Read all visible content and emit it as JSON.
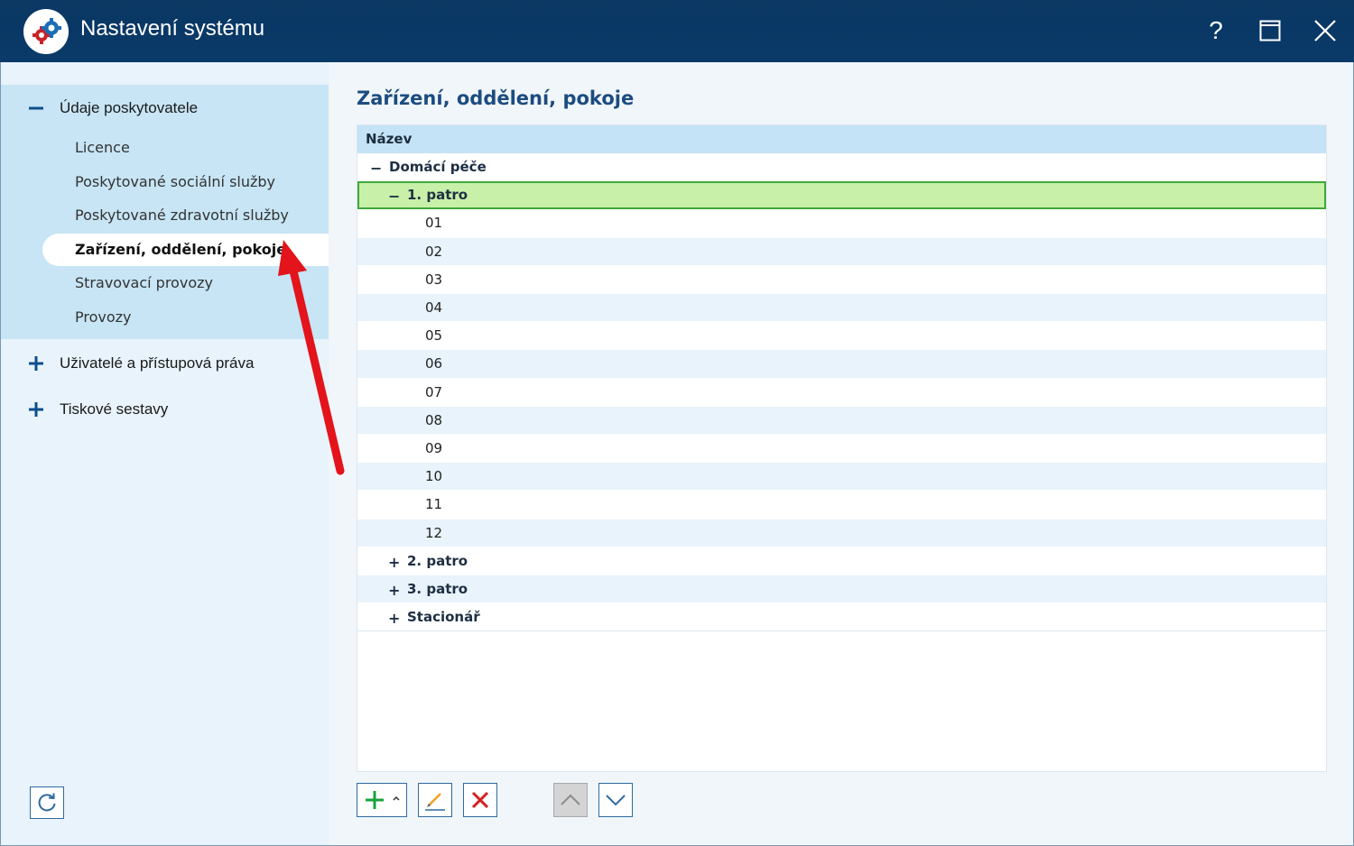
{
  "window": {
    "title": "Nastavení systému",
    "help_label": "?"
  },
  "sidebar": {
    "groups": [
      {
        "label": "Údaje poskytovatele",
        "expanded": true,
        "items": [
          {
            "label": "Licence"
          },
          {
            "label": "Poskytované sociální služby"
          },
          {
            "label": "Poskytované zdravotní služby"
          },
          {
            "label": "Zařízení, oddělení, pokoje",
            "active": true
          },
          {
            "label": "Stravovací provozy"
          },
          {
            "label": "Provozy"
          }
        ]
      },
      {
        "label": "Uživatelé a přístupová práva",
        "expanded": false
      },
      {
        "label": "Tiskové sestavy",
        "expanded": false
      }
    ]
  },
  "main": {
    "title": "Zařízení, oddělení, pokoje",
    "grid": {
      "column_header": "Název",
      "rows": [
        {
          "level": 0,
          "sign": "−",
          "label": "Domácí péče"
        },
        {
          "level": 1,
          "sign": "−",
          "label": "1. patro",
          "selected": true
        },
        {
          "level": 2,
          "label": "01"
        },
        {
          "level": 2,
          "label": "02"
        },
        {
          "level": 2,
          "label": "03"
        },
        {
          "level": 2,
          "label": "04"
        },
        {
          "level": 2,
          "label": "05"
        },
        {
          "level": 2,
          "label": "06"
        },
        {
          "level": 2,
          "label": "07"
        },
        {
          "level": 2,
          "label": "08"
        },
        {
          "level": 2,
          "label": "09"
        },
        {
          "level": 2,
          "label": "10"
        },
        {
          "level": 2,
          "label": "11"
        },
        {
          "level": 2,
          "label": "12"
        },
        {
          "level": 1,
          "sign": "+",
          "label": "2. patro"
        },
        {
          "level": 1,
          "sign": "+",
          "label": "3. patro"
        },
        {
          "level": 1,
          "sign": "+",
          "label": "Stacionář"
        }
      ]
    }
  },
  "colors": {
    "titlebar": "#093a69",
    "sidebar_bg": "#e8f3fb",
    "sidebar_expanded": "#c7e5f5",
    "selected_row": "#c8f0a8",
    "selected_border": "#3fa83c",
    "add_icon": "#1aa33b",
    "delete_icon": "#d42020",
    "annotation_arrow": "#e3141b"
  },
  "icons": {
    "app": "gears-icon",
    "help": "help-icon",
    "maximize": "maximize-icon",
    "close": "close-icon",
    "refresh": "refresh-icon",
    "add": "plus-icon",
    "edit": "pencil-icon",
    "delete": "x-icon",
    "move_up": "chevron-up-icon",
    "move_down": "chevron-down-icon"
  }
}
